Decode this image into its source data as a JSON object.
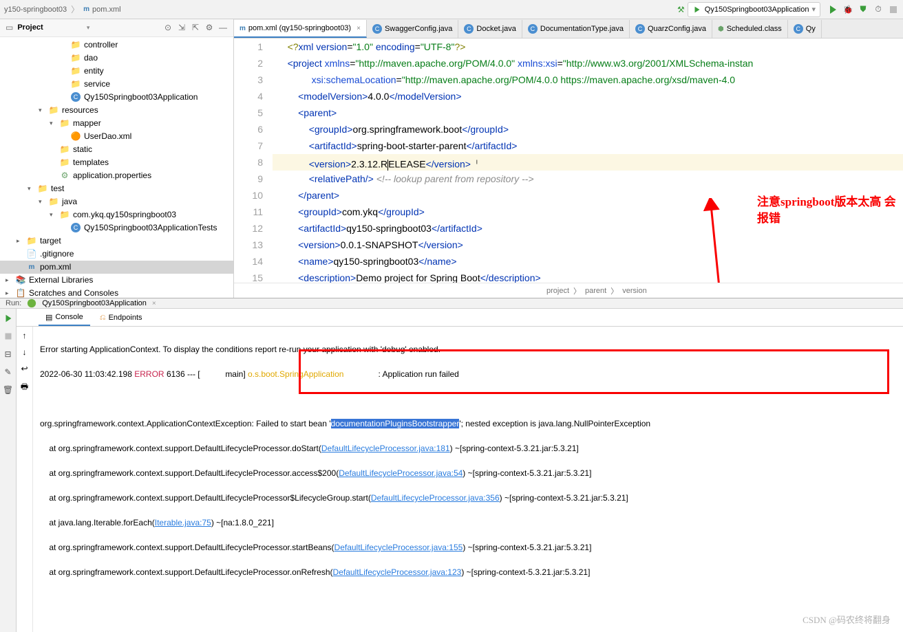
{
  "breadcrumb": {
    "parent": "y150-springboot03",
    "file": "pom.xml"
  },
  "run_config": {
    "selected": "Qy150Springboot03Application"
  },
  "project_panel": {
    "title": "Project"
  },
  "tree": {
    "items": [
      {
        "indent": 80,
        "arrow": "",
        "icon": "folder-b",
        "label": "controller"
      },
      {
        "indent": 80,
        "arrow": "",
        "icon": "folder-b",
        "label": "dao"
      },
      {
        "indent": 80,
        "arrow": "",
        "icon": "folder-b",
        "label": "entity"
      },
      {
        "indent": 80,
        "arrow": "",
        "icon": "folder-b",
        "label": "service"
      },
      {
        "indent": 80,
        "arrow": "",
        "icon": "class",
        "label": "Qy150Springboot03Application"
      },
      {
        "indent": 48,
        "arrow": "▾",
        "icon": "folder-y",
        "label": "resources"
      },
      {
        "indent": 64,
        "arrow": "▾",
        "icon": "folder-b",
        "label": "mapper"
      },
      {
        "indent": 80,
        "arrow": "",
        "icon": "xml-f",
        "label": "UserDao.xml"
      },
      {
        "indent": 64,
        "arrow": "",
        "icon": "folder-y",
        "label": "static"
      },
      {
        "indent": 64,
        "arrow": "",
        "icon": "folder-y",
        "label": "templates"
      },
      {
        "indent": 64,
        "arrow": "",
        "icon": "prop-f",
        "label": "application.properties"
      },
      {
        "indent": 32,
        "arrow": "▾",
        "icon": "folder-b",
        "label": "test"
      },
      {
        "indent": 48,
        "arrow": "▾",
        "icon": "folder-test",
        "label": "java"
      },
      {
        "indent": 64,
        "arrow": "▾",
        "icon": "folder-b",
        "label": "com.ykq.qy150springboot03"
      },
      {
        "indent": 80,
        "arrow": "",
        "icon": "class",
        "label": "Qy150Springboot03ApplicationTests"
      },
      {
        "indent": 16,
        "arrow": "▸",
        "icon": "folder-exc",
        "label": "target"
      },
      {
        "indent": 16,
        "arrow": "",
        "icon": "txt-f",
        "label": ".gitignore"
      },
      {
        "indent": 16,
        "arrow": "",
        "icon": "maven-f",
        "label": "pom.xml",
        "selected": true
      },
      {
        "indent": 0,
        "arrow": "▸",
        "icon": "lib-f",
        "label": "External Libraries"
      },
      {
        "indent": 0,
        "arrow": "▸",
        "icon": "scratch-f",
        "label": "Scratches and Consoles"
      }
    ]
  },
  "tabs": [
    {
      "icon": "maven",
      "label": "pom.xml (qy150-springboot03)",
      "active": true,
      "closable": true
    },
    {
      "icon": "java",
      "label": "SwaggerConfig.java"
    },
    {
      "icon": "java",
      "label": "Docket.java"
    },
    {
      "icon": "java",
      "label": "DocumentationType.java"
    },
    {
      "icon": "java",
      "label": "QuarzConfig.java"
    },
    {
      "icon": "class",
      "label": "Scheduled.class"
    },
    {
      "icon": "java",
      "label": "Qy"
    }
  ],
  "code": {
    "pre_version": "2.3.12.R",
    "post_version": "ELEASE",
    "tag_project": "project",
    "attr_xmlns": "xmlns",
    "attr_xsi": "xmlns:xsi",
    "attr_schema": ":schemaLocation",
    "val_xsi": "\"http://www.w3.org/2001/XMLSchema-instan",
    "val_xmlns": "\"http://maven.apache.org/POM/4.0.0\"",
    "val_schema": "\"http://maven.apache.org/POM/4.0.0 https://maven.apache.org/xsd/maven-4.0",
    "comment_lookup": "<!-- lookup parent from repository -->",
    "desc_text": "Demo project for Spring Boot",
    "groupId": "org.springframework.boot",
    "artifactId_parent": "spring-boot-starter-parent",
    "groupId2": "com.ykq",
    "artifactId2": "qy150-springboot03",
    "version2": "0.0.1-SNAPSHOT",
    "name2": "qy150-springboot03",
    "modelVersion": "4.0.0"
  },
  "line_numbers": [
    "1",
    "2",
    "3",
    "4",
    "5",
    "6",
    "7",
    "8",
    "9",
    "10",
    "11",
    "12",
    "13",
    "14",
    "15"
  ],
  "annotation": "注意springboot版本太高  会报错",
  "code_breadcrumb": [
    "project",
    "parent",
    "version"
  ],
  "run": {
    "label": "Run:",
    "config": "Qy150Springboot03Application",
    "tab_console": "Console",
    "tab_endpoints": "Endpoints"
  },
  "console": {
    "l1a": "Error starting ApplicationContext. To display the conditions report re-run your application with 'debug' enabled.",
    "ts": "2022-06-30 11:03:42.198",
    "level": "ERROR",
    "pid": "6136",
    "thread": "main",
    "logger": "o.s.boot.SpringApplication",
    "msg1": "Application run failed",
    "ex_pre": "org.springframework.context.ApplicationContextException: Failed to start bean '",
    "ex_sel": "documentationPluginsBootstrapper",
    "ex_post": "'; nested exception is java.lang.NullPointerException",
    "st1a": "    at org.springframework.context.support.DefaultLifecycleProcessor.doStart(",
    "st1b": "DefaultLifecycleProcessor.java:181",
    "st1c": ") ~[spring-context-5.3.21.jar:5.3.21]",
    "st2a": "    at org.springframework.context.support.DefaultLifecycleProcessor.access$200(",
    "st2b": "DefaultLifecycleProcessor.java:54",
    "st2c": ") ~[spring-context-5.3.21.jar:5.3.21]",
    "st3a": "    at org.springframework.context.support.DefaultLifecycleProcessor$LifecycleGroup.start(",
    "st3b": "DefaultLifecycleProcessor.java:356",
    "st3c": ") ~[spring-context-5.3.21.jar:5.3.21]",
    "st4a": "    at java.lang.Iterable.forEach(",
    "st4b": "Iterable.java:75",
    "st4c": ") ~[na:1.8.0_221]",
    "st5a": "    at org.springframework.context.support.DefaultLifecycleProcessor.startBeans(",
    "st5b": "DefaultLifecycleProcessor.java:155",
    "st5c": ") ~[spring-context-5.3.21.jar:5.3.21]",
    "st6a": "    at org.springframework.context.support.DefaultLifecycleProcessor.onRefresh(",
    "st6b": "DefaultLifecycleProcessor.java:123",
    "st6c": ") ~[spring-context-5.3.21.jar:5.3.21]"
  },
  "watermark": "CSDN @码农终将翻身"
}
